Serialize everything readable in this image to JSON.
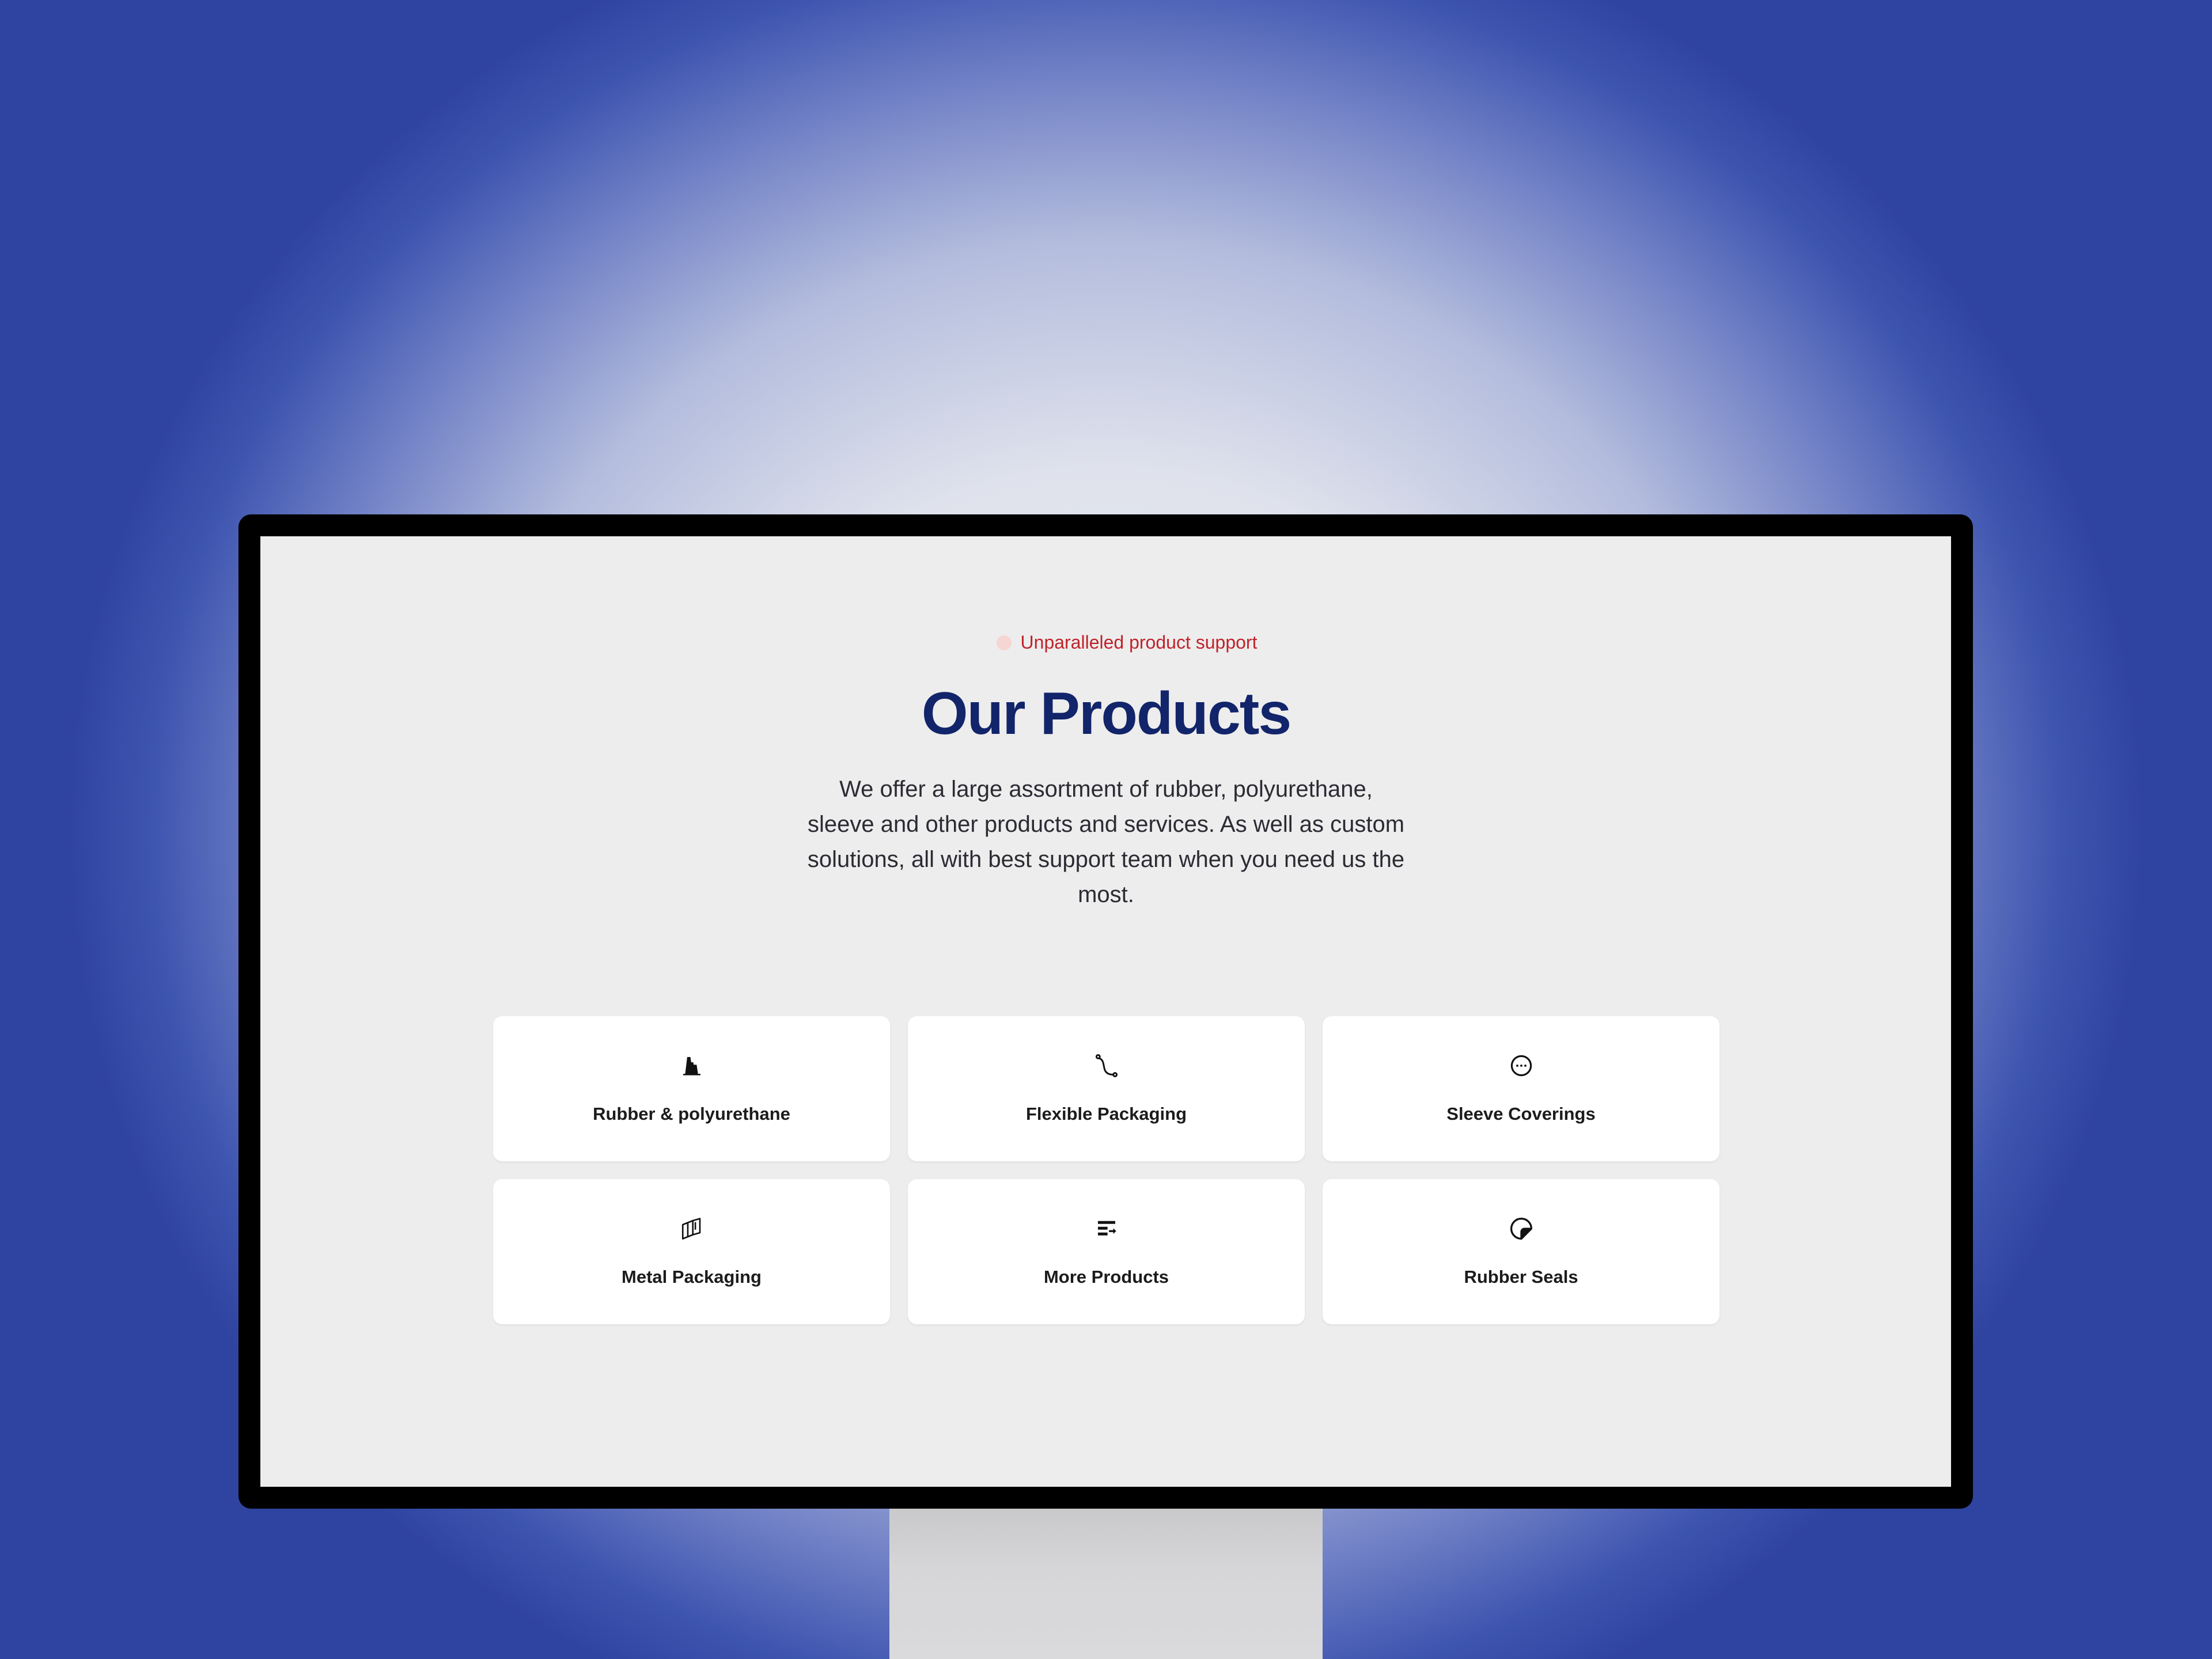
{
  "eyebrow": {
    "text": "Unparalleled product support"
  },
  "title": "Our Products",
  "description": "We offer a large assortment of rubber, polyurethane, sleeve and other products and services. As well as custom solutions, all with best support team when you need us the most.",
  "products": [
    {
      "label": "Rubber & polyurethane",
      "icon": "factory-icon"
    },
    {
      "label": "Flexible Packaging",
      "icon": "curve-path-icon"
    },
    {
      "label": "Sleeve Coverings",
      "icon": "circle-ellipsis-icon"
    },
    {
      "label": "Metal Packaging",
      "icon": "stacked-boxes-icon"
    },
    {
      "label": "More Products",
      "icon": "list-arrow-icon"
    },
    {
      "label": "Rubber Seals",
      "icon": "sticker-icon"
    }
  ],
  "colors": {
    "accent_red": "#c0222a",
    "title_navy": "#12246a",
    "screen_bg": "#ededed",
    "backdrop_blue": "#2f44a0"
  }
}
